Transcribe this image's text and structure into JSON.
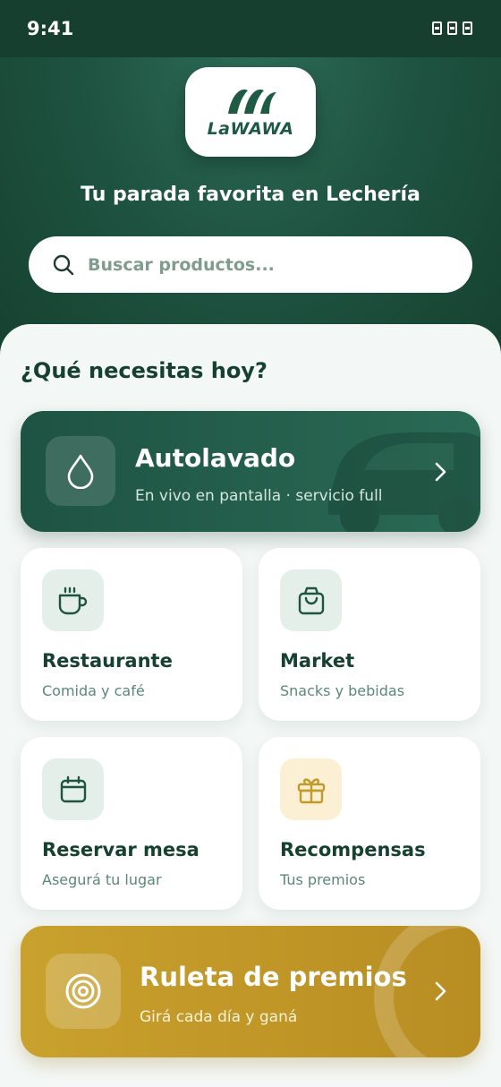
{
  "status_bar": {
    "time": "9:41"
  },
  "header": {
    "brand": "LaWAWA",
    "tagline": "Tu parada favorita en Lechería"
  },
  "search": {
    "placeholder": "Buscar productos..."
  },
  "section": {
    "title": "¿Qué necesitas hoy?"
  },
  "carwash": {
    "title": "Autolavado",
    "subtitle": "En vivo en pantalla · servicio full",
    "icon": "drop-icon"
  },
  "tiles": [
    {
      "title": "Restaurante",
      "subtitle": "Comida y café",
      "icon": "coffee-cup-icon"
    },
    {
      "title": "Market",
      "subtitle": "Snacks y bebidas",
      "icon": "shopping-bag-icon"
    },
    {
      "title": "Reservar mesa",
      "subtitle": "Asegurá tu lugar",
      "icon": "calendar-icon"
    },
    {
      "title": "Recompensas",
      "subtitle": "Tus premios",
      "icon": "gift-icon"
    }
  ],
  "roulette": {
    "title": "Ruleta de premios",
    "subtitle": "Girá cada día y ganá",
    "icon": "target-icon"
  },
  "colors": {
    "primary": "#1f5442",
    "accent_gold": "#c29a2a",
    "background": "#f3f7f5"
  }
}
